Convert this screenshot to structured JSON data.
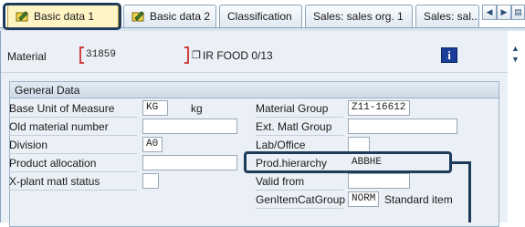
{
  "tabs": [
    {
      "label": "Basic data 1",
      "active": true,
      "has_icon": true
    },
    {
      "label": "Basic data 2",
      "active": false,
      "has_icon": true
    },
    {
      "label": "Classification",
      "active": false,
      "has_icon": false
    },
    {
      "label": "Sales: sales org. 1",
      "active": false,
      "has_icon": false
    },
    {
      "label": "Sales: sal...",
      "active": false,
      "has_icon": false
    }
  ],
  "header": {
    "material_label": "Material",
    "material_value": "31859",
    "material_description": "IR FOOD 0/13",
    "info_button_glyph": "i"
  },
  "general_data": {
    "title": "General Data",
    "base_uom_label": "Base Unit of Measure",
    "base_uom_value": "KG",
    "base_uom_text": "kg",
    "old_material_label": "Old material number",
    "old_material_value": "",
    "division_label": "Division",
    "division_value": "A0",
    "product_allocation_label": "Product allocation",
    "product_allocation_value": "",
    "xplant_status_label": "X-plant matl status",
    "xplant_status_value": "",
    "material_group_label": "Material Group",
    "material_group_value": "Z11-16612",
    "ext_matl_group_label": "Ext. Matl Group",
    "ext_matl_group_value": "",
    "lab_office_label": "Lab/Office",
    "lab_office_value": "",
    "prod_hierarchy_label": "Prod.hierarchy",
    "prod_hierarchy_value": "ABBHE",
    "valid_from_label": "Valid from",
    "valid_from_value": "",
    "gen_item_cat_label": "GenItemCatGroup",
    "gen_item_cat_value": "NORM",
    "gen_item_cat_text": "Standard item"
  },
  "colors": {
    "highlight": "#1f3b5a",
    "active_tab": "#fff4c4",
    "panel_bg": "#eaf0f5",
    "required_marker": "#d04040"
  }
}
